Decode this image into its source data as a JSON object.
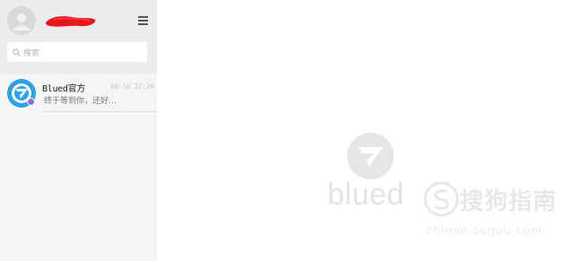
{
  "colors": {
    "sidebar_bg": "#f5f5f5",
    "header_bg": "#ececec",
    "accent_blue": "#2aa4e6",
    "badge_purple": "#8a6fe0",
    "redaction_red": "#e8151a"
  },
  "header": {
    "avatar_icon": "user-avatar-icon",
    "menu_icon": "menu-icon"
  },
  "search": {
    "icon": "search-icon",
    "placeholder": "搜索"
  },
  "conversations": [
    {
      "name": "Blued官方",
      "time": "08-16 22:20",
      "preview": "终于等到你，还好…",
      "avatar_icon": "blued-logo-icon",
      "badge_icon": "verified-badge-icon"
    }
  ],
  "main": {
    "empty_logo_icon": "blued-logo-icon",
    "wordmark": "blued"
  },
  "watermark": {
    "text": "搜狗指南",
    "url": "zhinan.sogou.com",
    "icon": "sogou-logo-icon"
  }
}
